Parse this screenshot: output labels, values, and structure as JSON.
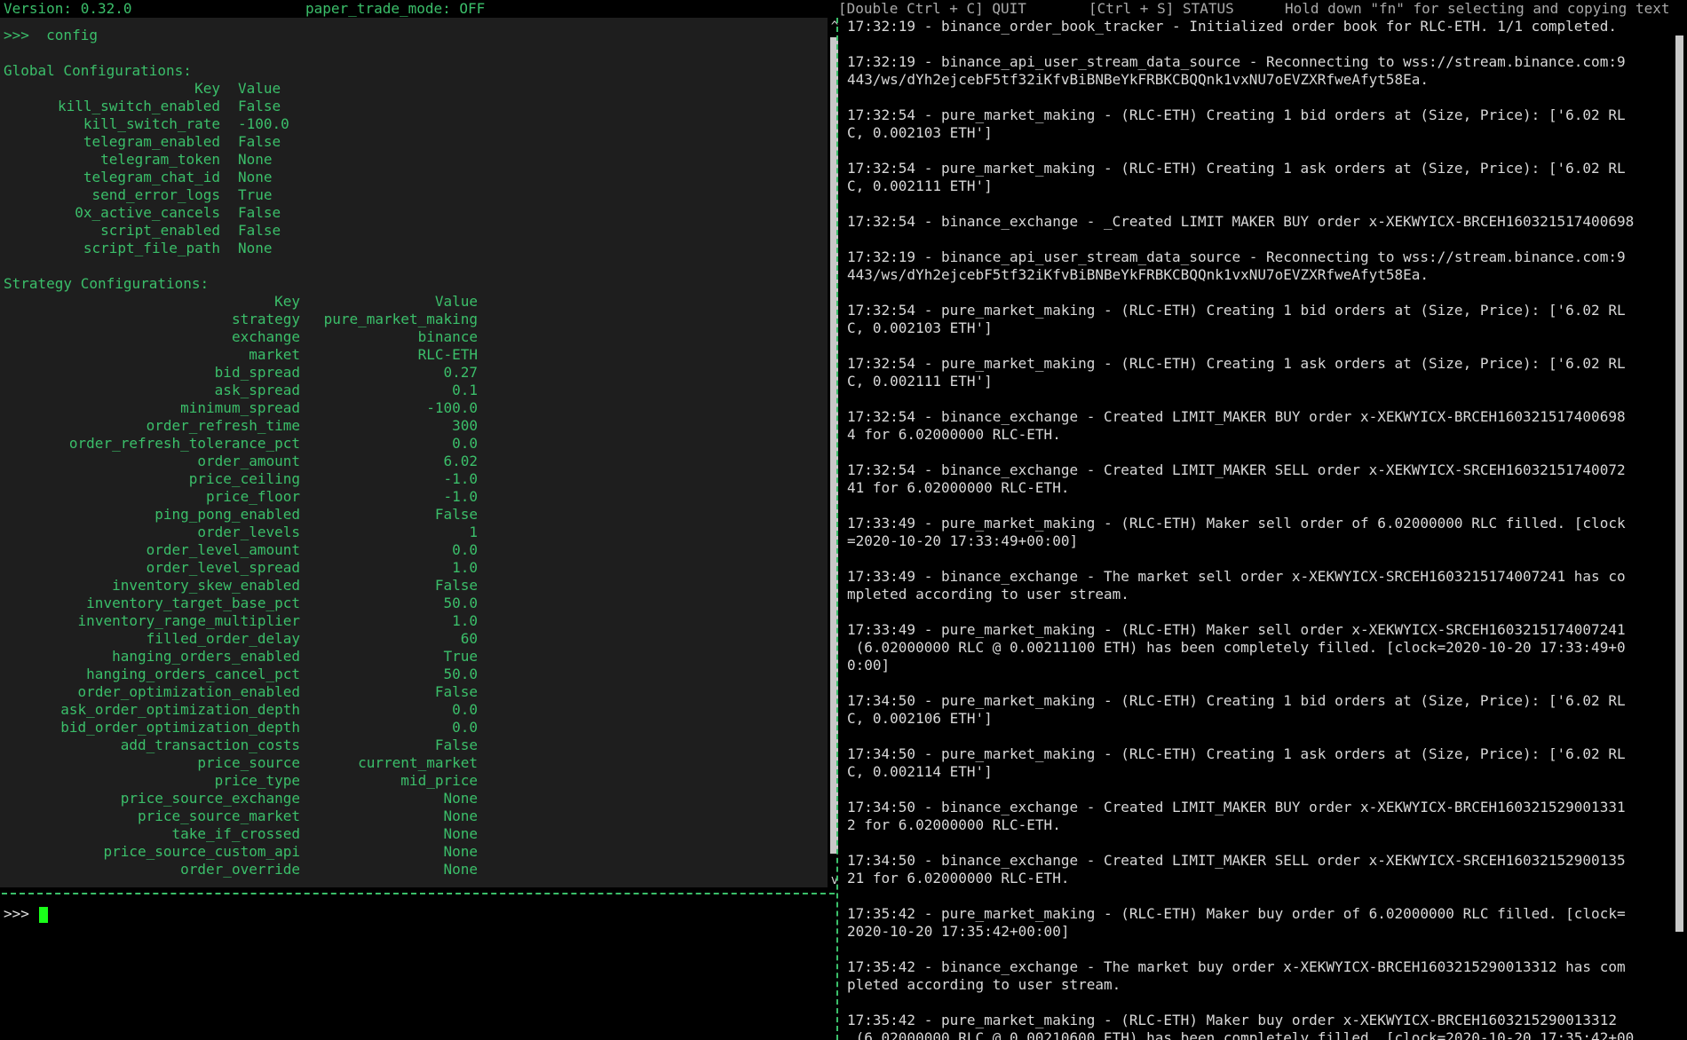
{
  "top_bar": {
    "version": "Version: 0.32.0",
    "paper_mode": "paper_trade_mode: OFF"
  },
  "right_bar": {
    "quit": "[Double Ctrl + C] QUIT",
    "status": "[Ctrl + S] STATUS",
    "hint": "Hold down \"fn\" for selecting and copying text"
  },
  "output": {
    "command_line": ">>>  config",
    "global_title": "Global Configurations:",
    "global_header": {
      "key": "Key",
      "value": "Value"
    },
    "global_rows": [
      {
        "key": "kill_switch_enabled",
        "value": "False"
      },
      {
        "key": "kill_switch_rate",
        "value": "-100.0"
      },
      {
        "key": "telegram_enabled",
        "value": "False"
      },
      {
        "key": "telegram_token",
        "value": "None"
      },
      {
        "key": "telegram_chat_id",
        "value": "None"
      },
      {
        "key": "send_error_logs",
        "value": "True"
      },
      {
        "key": "0x_active_cancels",
        "value": "False"
      },
      {
        "key": "script_enabled",
        "value": "False"
      },
      {
        "key": "script_file_path",
        "value": "None"
      }
    ],
    "strategy_title": "Strategy Configurations:",
    "strategy_header": {
      "key": "Key",
      "value": "Value"
    },
    "strategy_rows": [
      {
        "key": "strategy",
        "value": "pure_market_making"
      },
      {
        "key": "exchange",
        "value": "binance"
      },
      {
        "key": "market",
        "value": "RLC-ETH"
      },
      {
        "key": "bid_spread",
        "value": "0.27"
      },
      {
        "key": "ask_spread",
        "value": "0.1"
      },
      {
        "key": "minimum_spread",
        "value": "-100.0"
      },
      {
        "key": "order_refresh_time",
        "value": "300"
      },
      {
        "key": "order_refresh_tolerance_pct",
        "value": "0.0"
      },
      {
        "key": "order_amount",
        "value": "6.02"
      },
      {
        "key": "price_ceiling",
        "value": "-1.0"
      },
      {
        "key": "price_floor",
        "value": "-1.0"
      },
      {
        "key": "ping_pong_enabled",
        "value": "False"
      },
      {
        "key": "order_levels",
        "value": "1"
      },
      {
        "key": "order_level_amount",
        "value": "0.0"
      },
      {
        "key": "order_level_spread",
        "value": "1.0"
      },
      {
        "key": "inventory_skew_enabled",
        "value": "False"
      },
      {
        "key": "inventory_target_base_pct",
        "value": "50.0"
      },
      {
        "key": "inventory_range_multiplier",
        "value": "1.0"
      },
      {
        "key": "filled_order_delay",
        "value": "60"
      },
      {
        "key": "hanging_orders_enabled",
        "value": "True"
      },
      {
        "key": "hanging_orders_cancel_pct",
        "value": "50.0"
      },
      {
        "key": "order_optimization_enabled",
        "value": "False"
      },
      {
        "key": "ask_order_optimization_depth",
        "value": "0.0"
      },
      {
        "key": "bid_order_optimization_depth",
        "value": "0.0"
      },
      {
        "key": "add_transaction_costs",
        "value": "False"
      },
      {
        "key": "price_source",
        "value": "current_market"
      },
      {
        "key": "price_type",
        "value": "mid_price"
      },
      {
        "key": "price_source_exchange",
        "value": "None"
      },
      {
        "key": "price_source_market",
        "value": "None"
      },
      {
        "key": "take_if_crossed",
        "value": "None"
      },
      {
        "key": "price_source_custom_api",
        "value": "None"
      },
      {
        "key": "order_override",
        "value": "None"
      }
    ]
  },
  "input": {
    "prompt": ">>>"
  },
  "log_lines": [
    [
      "17:32:19 - binance_order_book_tracker - Initialized order book for RLC-ETH. 1/1 completed."
    ],
    [
      "17:32:19 - binance_api_user_stream_data_source - Reconnecting to wss://stream.binance.com:9",
      "443/ws/dYh2ejcebF5tf32iKfvBiBNBeYkFRBKCBQQnk1vxNU7oEVZXRfweAfyt58Ea."
    ],
    [
      "17:32:54 - pure_market_making - (RLC-ETH) Creating 1 bid orders at (Size, Price): ['6.02 RL",
      "C, 0.002103 ETH']"
    ],
    [
      "17:32:54 - pure_market_making - (RLC-ETH) Creating 1 ask orders at (Size, Price): ['6.02 RL",
      "C, 0.002111 ETH']"
    ],
    [
      "17:32:54 - binance_exchange - _Created LIMIT MAKER BUY order x-XEKWYICX-BRCEH160321517400698"
    ],
    [
      "17:32:19 - binance_api_user_stream_data_source - Reconnecting to wss://stream.binance.com:9",
      "443/ws/dYh2ejcebF5tf32iKfvBiBNBeYkFRBKCBQQnk1vxNU7oEVZXRfweAfyt58Ea."
    ],
    [
      "17:32:54 - pure_market_making - (RLC-ETH) Creating 1 bid orders at (Size, Price): ['6.02 RL",
      "C, 0.002103 ETH']"
    ],
    [
      "17:32:54 - pure_market_making - (RLC-ETH) Creating 1 ask orders at (Size, Price): ['6.02 RL",
      "C, 0.002111 ETH']"
    ],
    [
      "17:32:54 - binance_exchange - Created LIMIT_MAKER BUY order x-XEKWYICX-BRCEH160321517400698",
      "4 for 6.02000000 RLC-ETH."
    ],
    [
      "17:32:54 - binance_exchange - Created LIMIT_MAKER SELL order x-XEKWYICX-SRCEH16032151740072",
      "41 for 6.02000000 RLC-ETH."
    ],
    [
      "17:33:49 - pure_market_making - (RLC-ETH) Maker sell order of 6.02000000 RLC filled. [clock",
      "=2020-10-20 17:33:49+00:00]"
    ],
    [
      "17:33:49 - binance_exchange - The market sell order x-XEKWYICX-SRCEH1603215174007241 has co",
      "mpleted according to user stream."
    ],
    [
      "17:33:49 - pure_market_making - (RLC-ETH) Maker sell order x-XEKWYICX-SRCEH1603215174007241",
      " (6.02000000 RLC @ 0.00211100 ETH) has been completely filled. [clock=2020-10-20 17:33:49+0",
      "0:00]"
    ],
    [
      "17:34:50 - pure_market_making - (RLC-ETH) Creating 1 bid orders at (Size, Price): ['6.02 RL",
      "C, 0.002106 ETH']"
    ],
    [
      "17:34:50 - pure_market_making - (RLC-ETH) Creating 1 ask orders at (Size, Price): ['6.02 RL",
      "C, 0.002114 ETH']"
    ],
    [
      "17:34:50 - binance_exchange - Created LIMIT_MAKER BUY order x-XEKWYICX-BRCEH160321529001331",
      "2 for 6.02000000 RLC-ETH."
    ],
    [
      "17:34:50 - binance_exchange - Created LIMIT_MAKER SELL order x-XEKWYICX-SRCEH16032152900135",
      "21 for 6.02000000 RLC-ETH."
    ],
    [
      "17:35:42 - pure_market_making - (RLC-ETH) Maker buy order of 6.02000000 RLC filled. [clock=",
      "2020-10-20 17:35:42+00:00]"
    ],
    [
      "17:35:42 - binance_exchange - The market buy order x-XEKWYICX-BRCEH1603215290013312 has com",
      "pleted according to user stream."
    ],
    [
      "17:35:42 - pure_market_making - (RLC-ETH) Maker buy order x-XEKWYICX-BRCEH1603215290013312",
      " (6.02000000 RLC @ 0.00210600 ETH) has been completely filled. [clock=2020-10-20 17:35:42+00"
    ]
  ]
}
